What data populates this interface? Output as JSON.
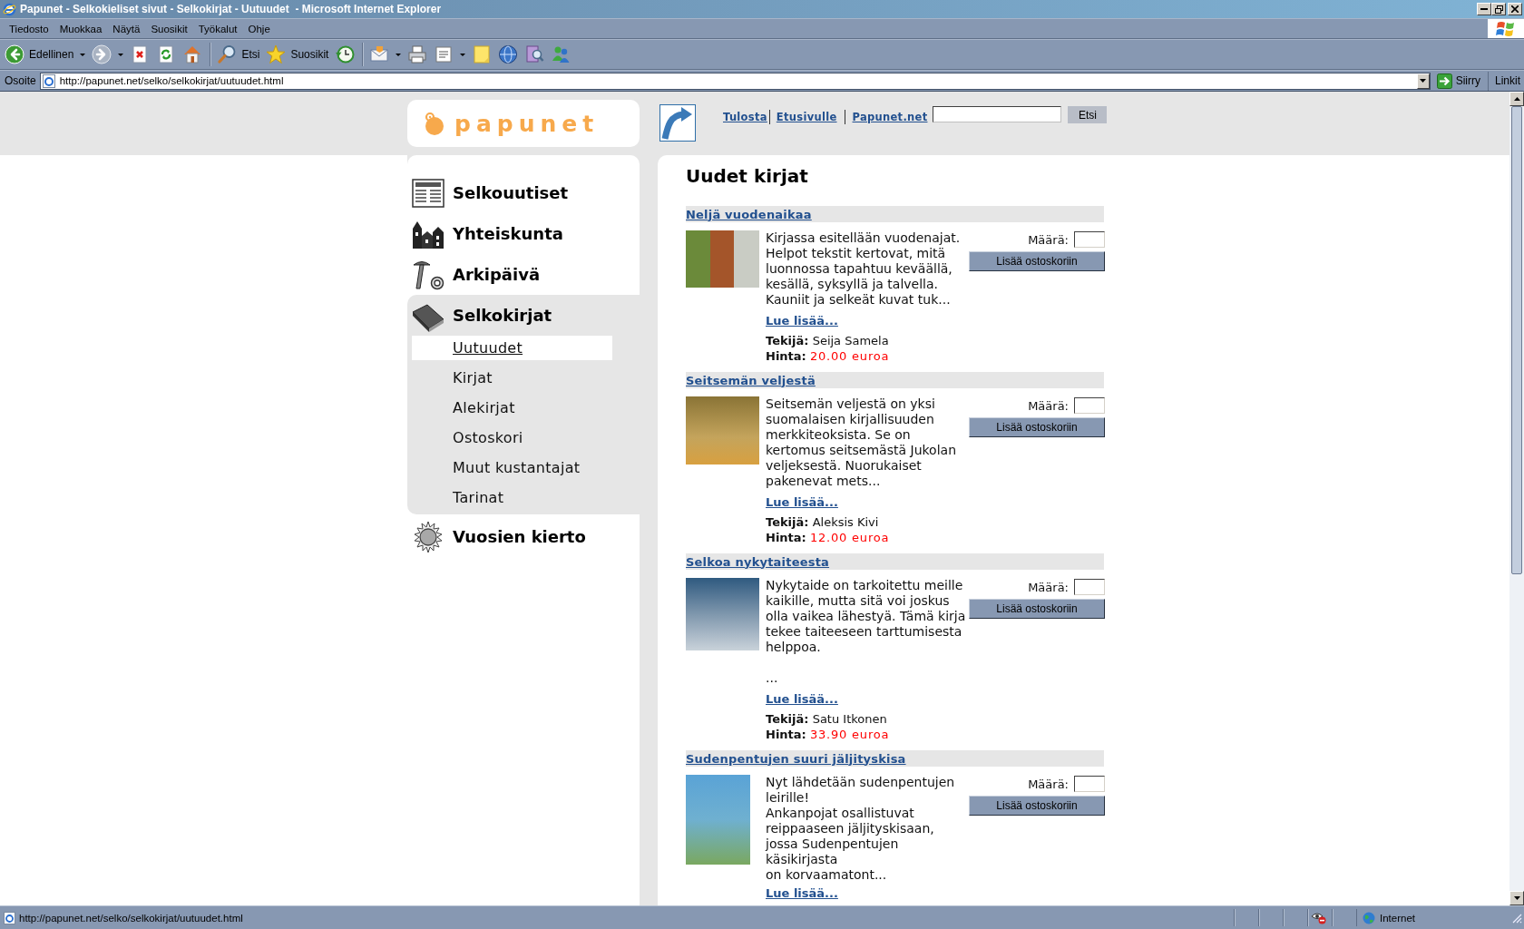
{
  "window": {
    "title": "Papunet - Selkokieliset sivut - Selkokirjat - Uutuudet  - Microsoft Internet Explorer"
  },
  "menu_bar": {
    "items": [
      "Tiedosto",
      "Muokkaa",
      "Näytä",
      "Suosikit",
      "Työkalut",
      "Ohje"
    ]
  },
  "toolbar": {
    "groups": [
      [
        {
          "kind": "back",
          "label": "Edellinen",
          "dropdown": true,
          "disabled": false
        },
        {
          "kind": "forward",
          "dropdown": true,
          "disabled": true
        },
        {
          "kind": "stop",
          "dropdown": false,
          "disabled": false
        },
        {
          "kind": "refresh",
          "dropdown": false,
          "disabled": false
        },
        {
          "kind": "home",
          "dropdown": false,
          "disabled": false
        }
      ],
      [
        {
          "kind": "search",
          "label": "Etsi",
          "dropdown": false,
          "disabled": false
        },
        {
          "kind": "favorites",
          "label": "Suosikit",
          "dropdown": false,
          "disabled": false
        },
        {
          "kind": "history",
          "dropdown": false,
          "disabled": false
        }
      ],
      [
        {
          "kind": "mail",
          "dropdown": true,
          "disabled": false
        },
        {
          "kind": "print",
          "dropdown": false,
          "disabled": false
        },
        {
          "kind": "edit",
          "dropdown": true,
          "disabled": false
        },
        {
          "kind": "note",
          "dropdown": false,
          "disabled": false
        },
        {
          "kind": "globe",
          "dropdown": false,
          "disabled": false
        },
        {
          "kind": "research",
          "dropdown": false,
          "disabled": false
        },
        {
          "kind": "messenger",
          "dropdown": false,
          "disabled": false
        }
      ]
    ]
  },
  "address_bar": {
    "label": "Osoite",
    "url": "http://papunet.net/selko/selkokirjat/uutuudet.html",
    "go_button": "Siirry",
    "links": "Linkit"
  },
  "page": {
    "logo": "papunet",
    "header_links": [
      "Tulosta",
      "Etusivulle",
      "Papunet.net"
    ],
    "search": {
      "button": "Etsi"
    },
    "nav": [
      {
        "kind": "news",
        "label": "Selkouutiset",
        "expanded": false
      },
      {
        "kind": "society",
        "label": "Yhteiskunta",
        "expanded": false
      },
      {
        "kind": "daily",
        "label": "Arkipäivä",
        "expanded": false
      },
      {
        "kind": "books",
        "label": "Selkokirjat",
        "expanded": true,
        "children": [
          {
            "label": "Uutuudet",
            "selected": true
          },
          {
            "label": "Kirjat",
            "selected": false
          },
          {
            "label": "Alekirjat",
            "selected": false
          },
          {
            "label": "Ostoskori",
            "selected": false
          },
          {
            "label": "Muut kustantajat",
            "selected": false
          },
          {
            "label": "Tarinat",
            "selected": false
          }
        ]
      },
      {
        "kind": "seasons",
        "label": "Vuosien kierto",
        "expanded": false
      }
    ],
    "heading": "Uudet kirjat",
    "books": [
      {
        "title": "Neljä vuodenaikaa",
        "description": "Kirjassa esitellään vuodenajat. Helpot tekstit kertovat, mitä luonnossa tapahtuu keväällä, kesällä, syksyllä ja talvella. Kauniit ja selkeät kuvat tuk...",
        "more": "Lue lisää...",
        "author_label": "Tekijä:",
        "author": "Seija Samela",
        "price_label": "Hinta:",
        "price": "20.00 euroa",
        "quantity_label": "Määrä:",
        "add_button": "Lisää ostoskoriin"
      },
      {
        "title": "Seitsemän veljestä",
        "description": "Seitsemän veljestä on yksi suomalaisen kirjallisuuden merkkiteoksista. Se on kertomus seitsemästä Jukolan veljeksestä. Nuorukaiset pakenevat mets...",
        "more": "Lue lisää...",
        "author_label": "Tekijä:",
        "author": "Aleksis Kivi",
        "price_label": "Hinta:",
        "price": "12.00 euroa",
        "quantity_label": "Määrä:",
        "add_button": "Lisää ostoskoriin"
      },
      {
        "title": "Selkoa nykytaiteesta",
        "description": "Nykytaide on tarkoitettu meille kaikille, mutta sitä voi joskus olla vaikea lähestyä. Tämä kirja tekee taiteeseen tarttumisesta helppoa.\n\n...",
        "more": "Lue lisää...",
        "author_label": "Tekijä:",
        "author": "Satu Itkonen",
        "price_label": "Hinta:",
        "price": "33.90 euroa",
        "quantity_label": "Määrä:",
        "add_button": "Lisää ostoskoriin"
      },
      {
        "title": "Sudenpentujen suuri jäljityskisa",
        "description": "Nyt lähdetään sudenpentujen leirille!\nAnkanpojat osallistuvat reippaaseen jäljityskisaan, jossa Sudenpentujen käsikirjasta\non korvaamatont...",
        "more": "Lue lisää...",
        "quantity_label": "Määrä:",
        "add_button": "Lisää ostoskoriin"
      }
    ]
  },
  "status_bar": {
    "text": "http://papunet.net/selko/selkokirjat/uutuudet.html",
    "zone": "Internet"
  }
}
